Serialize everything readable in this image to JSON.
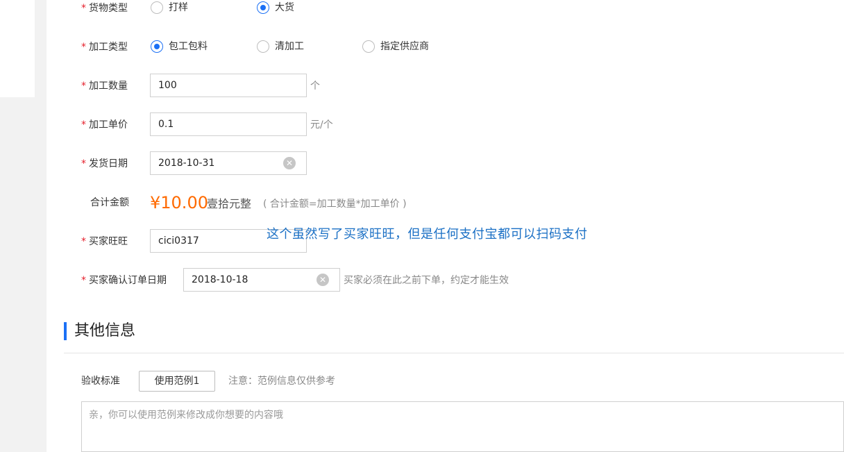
{
  "form": {
    "goods_type": {
      "label": "货物类型",
      "options": [
        "打样",
        "大货"
      ],
      "selected": "大货"
    },
    "process_type": {
      "label": "加工类型",
      "options": [
        "包工包料",
        "清加工",
        "指定供应商"
      ],
      "selected": "包工包料"
    },
    "quantity": {
      "label": "加工数量",
      "value": "100",
      "unit": "个"
    },
    "unit_price": {
      "label": "加工单价",
      "value": "0.1",
      "unit": "元/个"
    },
    "ship_date": {
      "label": "发货日期",
      "value": "2018-10-31"
    },
    "total": {
      "label": "合计金额",
      "amount": "¥10.00",
      "words": "壹拾元整",
      "formula": "( 合计金额=加工数量*加工单价 )"
    },
    "buyer_wangwang": {
      "label": "买家旺旺",
      "value": "cici0317"
    },
    "confirm_date": {
      "label": "买家确认订单日期",
      "value": "2018-10-18",
      "hint": "买家必须在此之前下单，约定才能生效"
    },
    "required_mark": "*"
  },
  "annotation": "这个虽然写了买家旺旺，但是任何支付宝都可以扫码支付",
  "other_info": {
    "title": "其他信息",
    "acceptance": {
      "label": "验收标准",
      "example_button": "使用范例1",
      "note": "注意：范例信息仅供参考",
      "placeholder": "亲，你可以使用范例来修改成你想要的内容哦"
    }
  },
  "colors": {
    "accent": "#1b70f5",
    "price": "#ff6a00",
    "required": "#e5202c",
    "annotation": "#1b70c5"
  }
}
